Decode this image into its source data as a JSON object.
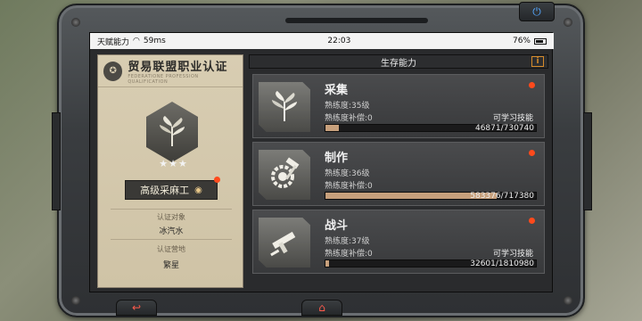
{
  "status_bar": {
    "carrier": "天赋能力",
    "latency": "59ms",
    "time": "22:03",
    "battery": "76%"
  },
  "certificate": {
    "title": "贸易联盟职业认证",
    "subtitle": "FEDERATIONE PROFESSION QUALIFICATION",
    "rank": "高级采麻工",
    "stars": 3,
    "target_label": "认证对象",
    "target_value": "冰汽水",
    "camp_label": "认证营地",
    "camp_value": "繁星"
  },
  "skills_panel": {
    "title": "生存能力",
    "info_label": "i",
    "skills": [
      {
        "name": "采集",
        "level": "熟练度:35级",
        "compensation": "熟练度补偿:0",
        "learn": "可学习技能",
        "progress_text": "46871/730740",
        "progress": 0.064,
        "icon": "plant-icon"
      },
      {
        "name": "制作",
        "level": "熟练度:36级",
        "compensation": "熟练度补偿:0",
        "learn": "",
        "progress_text": "583376/717380",
        "progress": 0.813,
        "icon": "gear-hammer-icon"
      },
      {
        "name": "战斗",
        "level": "熟练度:37级",
        "compensation": "熟练度补偿:0",
        "learn": "可学习技能",
        "progress_text": "32601/1810980",
        "progress": 0.018,
        "icon": "gun-icon"
      }
    ]
  },
  "colors": {
    "accent_red": "#ff4a1c",
    "progress_fill": "#c7a07c",
    "cert_bg": "#d8cdb2"
  }
}
